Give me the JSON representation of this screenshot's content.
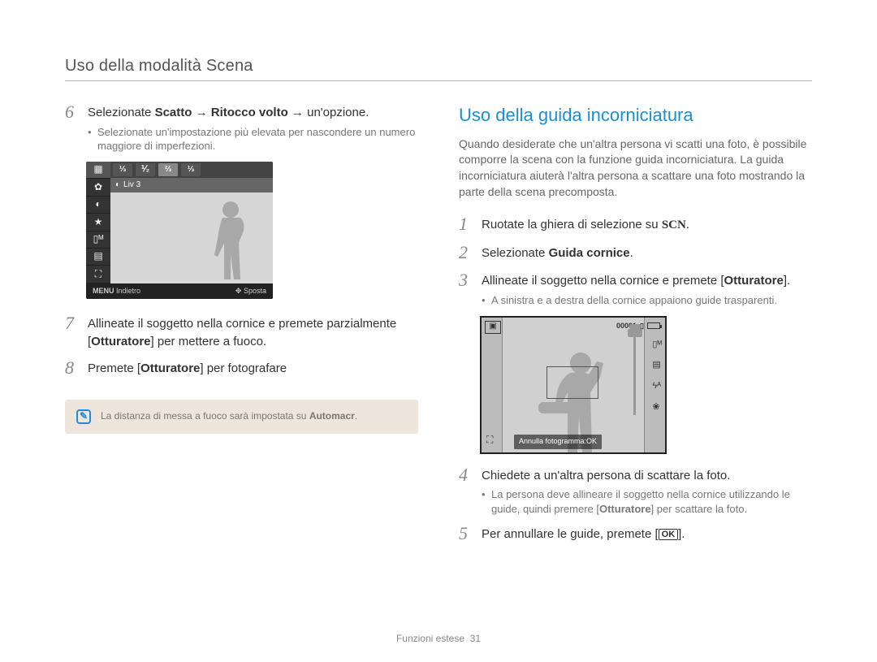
{
  "header": "Uso della modalità Scena",
  "left": {
    "step6": {
      "num": "6",
      "pre": "Selezionate ",
      "b1": "Scatto",
      "arrow1": " → ",
      "b2": "Ritocco volto",
      "arrow2": " → ",
      "post": "un'opzione.",
      "bullet": "Selezionate un'impostazione più elevata per nascondere un numero maggiore di imperfezioni."
    },
    "lcd1": {
      "opts": [
        "⅓",
        "⅟₂",
        "⅔",
        "⅓"
      ],
      "label_icon": "◐",
      "label": "Liv 3",
      "footer_left_icon": "MENU",
      "footer_left": "Indietro",
      "footer_right_icon": "✥",
      "footer_right": "Sposta"
    },
    "step7": {
      "num": "7",
      "line1": "Allineate il soggetto nella cornice e premete parzialmente",
      "line2_pre": "[",
      "line2_b": "Otturatore",
      "line2_post": "] per mettere a fuoco."
    },
    "step8": {
      "num": "8",
      "pre": "Premete [",
      "b": "Otturatore",
      "post": "] per fotografare"
    },
    "note": {
      "icon": "✎",
      "text_pre": "La distanza di messa a fuoco sarà impostata su ",
      "text_b": "Automacr",
      "text_post": "."
    }
  },
  "right": {
    "title": "Uso della guida incorniciatura",
    "intro": "Quando desiderate che un'altra persona vi scatti una foto, è possibile comporre la scena con la funzione guida incorniciatura. La guida incorniciatura aiuterà l'altra persona a scattare una foto mostrando la parte della scena precomposta.",
    "step1": {
      "num": "1",
      "pre": "Ruotate la ghiera di selezione su ",
      "scn": "SCN",
      "post": "."
    },
    "step2": {
      "num": "2",
      "pre": "Selezionate ",
      "b": "Guida cornice",
      "post": "."
    },
    "step3": {
      "num": "3",
      "pre": "Allineate il soggetto nella cornice e premete [",
      "b": "Otturatore",
      "post": "].",
      "bullet": "A sinistra e a destra della cornice appaiono guide trasparenti."
    },
    "lcd2": {
      "counter": "00001",
      "right_icons": [
        "▯ᴹ",
        "▤",
        "ϟᴬ",
        "❀"
      ],
      "bl_icon": "⛶",
      "footer_label": "Annulla fotogramma:OK"
    },
    "step4": {
      "num": "4",
      "main": "Chiedete a un'altra persona di scattare la foto.",
      "bullet_pre": "La persona deve allineare il soggetto nella cornice utilizzando le guide, quindi premere [",
      "bullet_b": "Otturatore",
      "bullet_post": "] per scattare la foto."
    },
    "step5": {
      "num": "5",
      "pre": "Per annullare le guide, premete [",
      "ok": "OK",
      "post": "]."
    }
  },
  "footer": {
    "label": "Funzioni estese",
    "page": "31"
  }
}
